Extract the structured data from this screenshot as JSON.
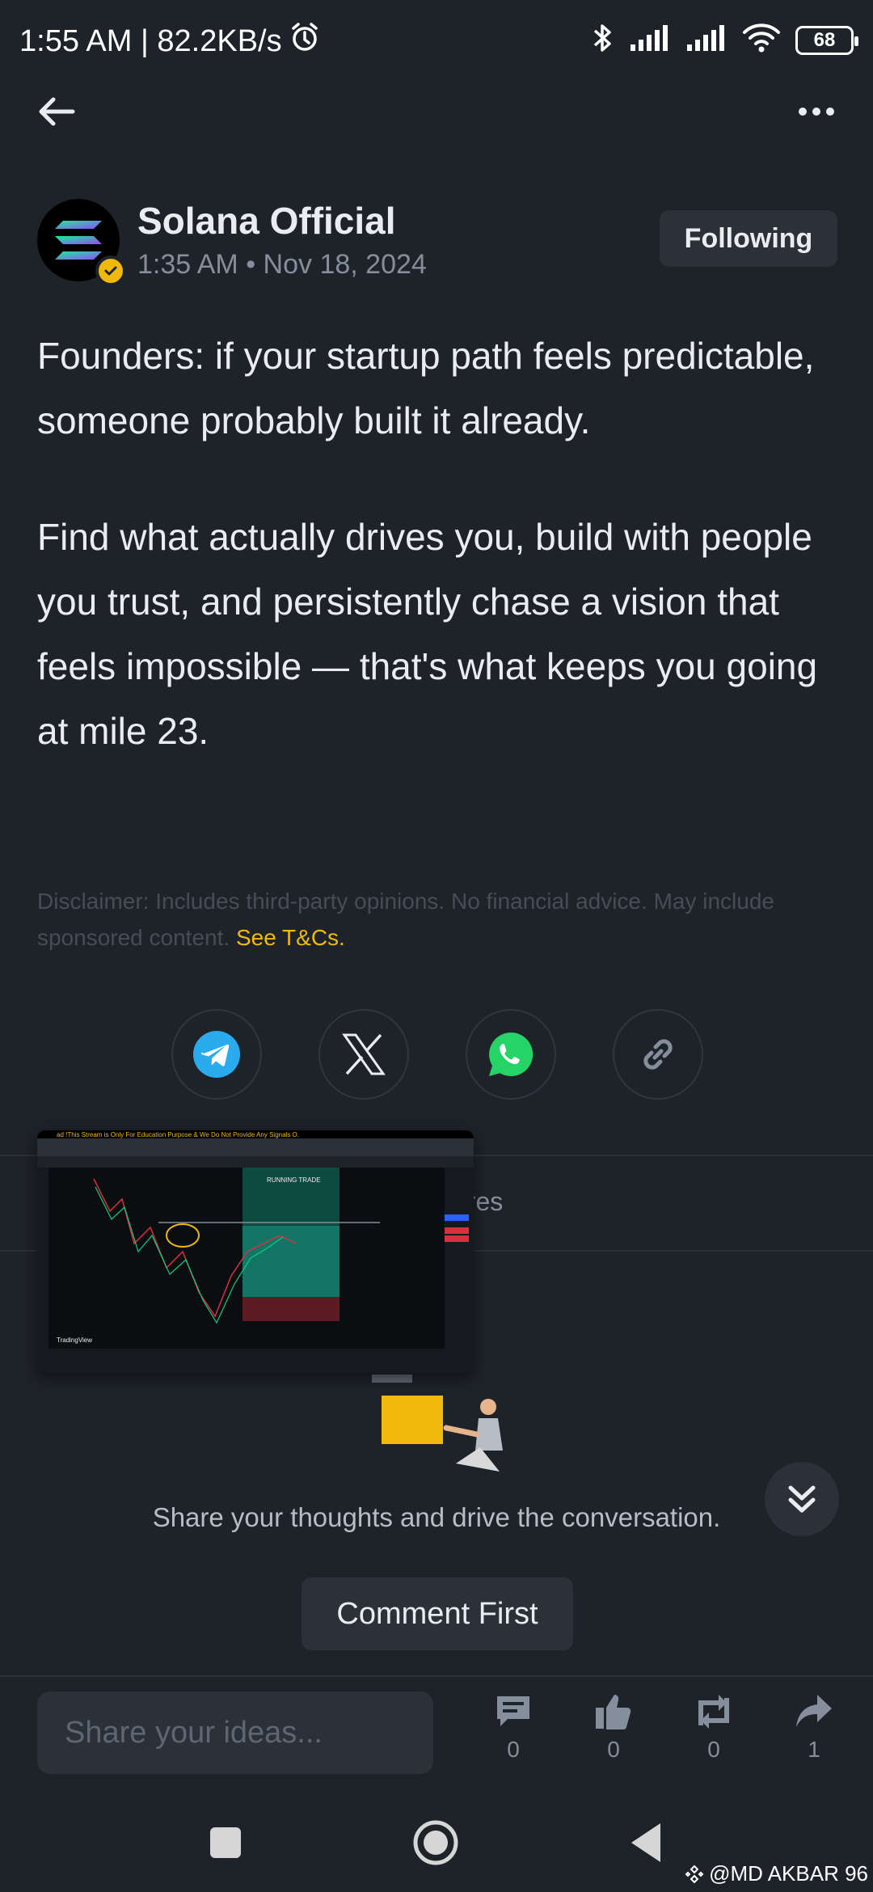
{
  "status_bar": {
    "time_speed": "1:55 AM | 82.2KB/s",
    "battery": "68"
  },
  "author": {
    "name": "Solana Official",
    "time": "1:35 AM • Nov 18, 2024",
    "follow_label": "Following"
  },
  "post": {
    "paragraphs": [
      "Founders: if your startup path feels predictable, someone probably built it already.",
      "Find what actually drives you, build with people you trust, and persistently chase a vision that feels impossible — that's what keeps you going at mile 23."
    ],
    "disclaimer": "Disclaimer: Includes third-party opinions. No financial advice. May include sponsored content.",
    "disclaimer_link": "See T&Cs."
  },
  "share": {
    "icons": [
      "telegram-icon",
      "x-icon",
      "whatsapp-icon",
      "link-icon"
    ]
  },
  "tabs": {
    "peek_label": "ares"
  },
  "video": {
    "banner": "ad !This Stream is Only For Education Purpose & We Do Not Provide Any Signals O.",
    "running_label": "RUNNING TRADE",
    "brand": "TradingView"
  },
  "empty_state": {
    "text": "Share your thoughts and drive the conversation.",
    "button": "Comment First"
  },
  "bottom_bar": {
    "input_placeholder": "Share your ideas...",
    "comments": "0",
    "likes": "0",
    "reposts": "0",
    "shares": "1"
  },
  "watermark": "@MD AKBAR 96",
  "colors": {
    "background": "#1e2329",
    "accent": "#f0b90b",
    "surface": "#2b3139",
    "muted": "#848e9c"
  }
}
